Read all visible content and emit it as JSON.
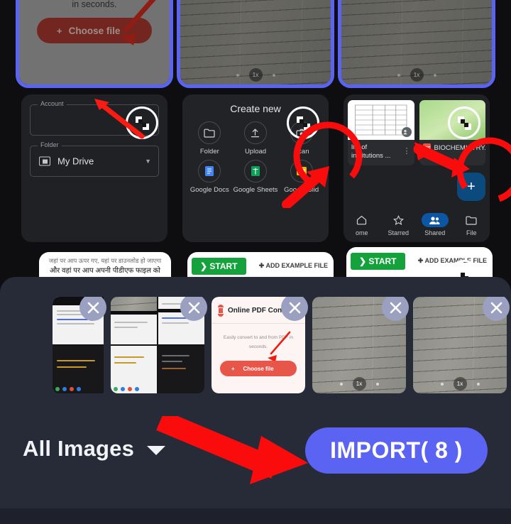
{
  "colors": {
    "accent_blue": "#5b63f2",
    "sheet_bg": "#272b38",
    "x_badge": "#9ba0c0",
    "annotation_red": "#ff0000",
    "pdf_red": "#e8564a",
    "drive_blue": "#0b57a4",
    "start_green": "#15a23c"
  },
  "grid": {
    "cards": [
      {
        "name": "pdf-converter-screenshot",
        "selected": true,
        "body_text": "Easily convert to and from PDF in seconds.",
        "button_label": "Choose file",
        "button_plus": "+"
      },
      {
        "name": "camera-scan-preview-1",
        "selected": true,
        "zoom_label": "1x"
      },
      {
        "name": "camera-scan-preview-2",
        "selected": true,
        "zoom_label": "1x"
      },
      {
        "name": "drive-account-folder-form",
        "selected": false,
        "account_label": "Account",
        "folder_label": "Folder",
        "folder_value": "My Drive"
      },
      {
        "name": "drive-create-new-sheet",
        "selected": false,
        "title": "Create new",
        "items": [
          {
            "label": "Folder",
            "icon": "folder-icon"
          },
          {
            "label": "Upload",
            "icon": "upload-icon"
          },
          {
            "label": "Scan",
            "icon": "camera-icon"
          },
          {
            "label": "Google Docs",
            "icon": "docs-icon"
          },
          {
            "label": "Google Sheets",
            "icon": "sheets-icon"
          },
          {
            "label": "Google Slid",
            "icon": "slides-icon"
          }
        ]
      },
      {
        "name": "drive-files-screenshot",
        "selected": false,
        "files": [
          {
            "name": "list of institutions ...",
            "kind": "sheet"
          },
          {
            "name": "BIOCHEMISTRY.pdf",
            "kind": "pdf",
            "chip": "PDF"
          }
        ],
        "nav": [
          {
            "label": "ome",
            "icon": "home-icon",
            "active": false
          },
          {
            "label": "Starred",
            "icon": "star-icon",
            "active": false
          },
          {
            "label": "Shared",
            "icon": "people-icon",
            "active": true
          },
          {
            "label": "File",
            "icon": "folder-icon",
            "active": false
          }
        ],
        "fab_label": "+"
      },
      {
        "name": "hindi-article-screenshot",
        "selected": false,
        "line_faint": "जहां पर आप ऊपर गए, यहां पर डाउनलोड हो जाएगा",
        "line_main": "और वहां पर आप अपनी पीडीएफ फाइल को किसी भी"
      },
      {
        "name": "start-tool-screenshot-1",
        "selected": false,
        "start_label": "START",
        "add_example_label": "ADD EXAMPLE FILE"
      },
      {
        "name": "start-tool-screenshot-2",
        "selected": false,
        "start_label": "START",
        "add_example_label": "ADD EXAMPLE FILE"
      }
    ]
  },
  "sheet": {
    "tray_items": [
      {
        "name": "selected-thumb-1",
        "type": "collage",
        "close_label": "✕"
      },
      {
        "name": "selected-thumb-2",
        "type": "collage",
        "close_label": "✕"
      },
      {
        "name": "selected-thumb-pdf-converter",
        "type": "pdf",
        "close_label": "✕",
        "title": "Online PDF Converter",
        "body_text": "Easily convert to and from PDF in seconds.",
        "button_label": "Choose file",
        "button_plus": "+"
      },
      {
        "name": "selected-thumb-scan-1",
        "type": "photo",
        "close_label": "✕"
      },
      {
        "name": "selected-thumb-scan-2",
        "type": "photo",
        "close_label": "✕"
      }
    ],
    "filter_label": "All Images",
    "import_label": "IMPORT( 8 )",
    "selected_count": 8
  }
}
